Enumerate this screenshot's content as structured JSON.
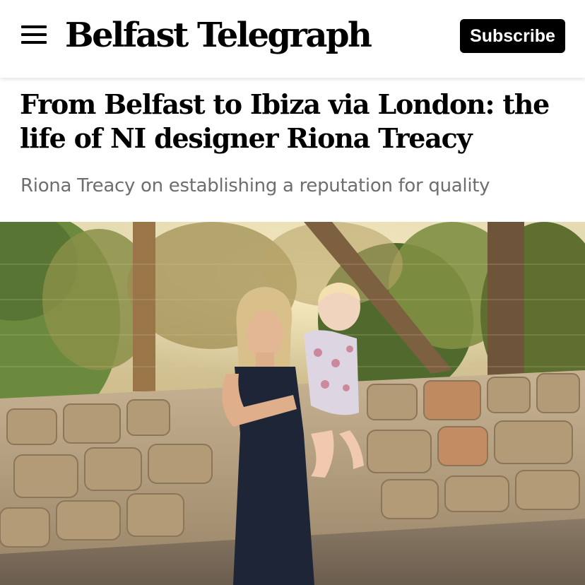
{
  "header": {
    "logo": "Belfast Telegraph",
    "subscribe_label": "Subscribe",
    "menu_icon": "hamburger-menu-icon"
  },
  "article": {
    "headline": "From Belfast to Ibiza via London: the life of NI designer Riona Treacy",
    "standfirst": "Riona Treacy on establishing a reputation for quality"
  },
  "colors": {
    "header_bg": "#ffffff",
    "button_bg": "#000000",
    "button_text": "#ffffff",
    "standfirst_text": "#6e6e6e"
  }
}
